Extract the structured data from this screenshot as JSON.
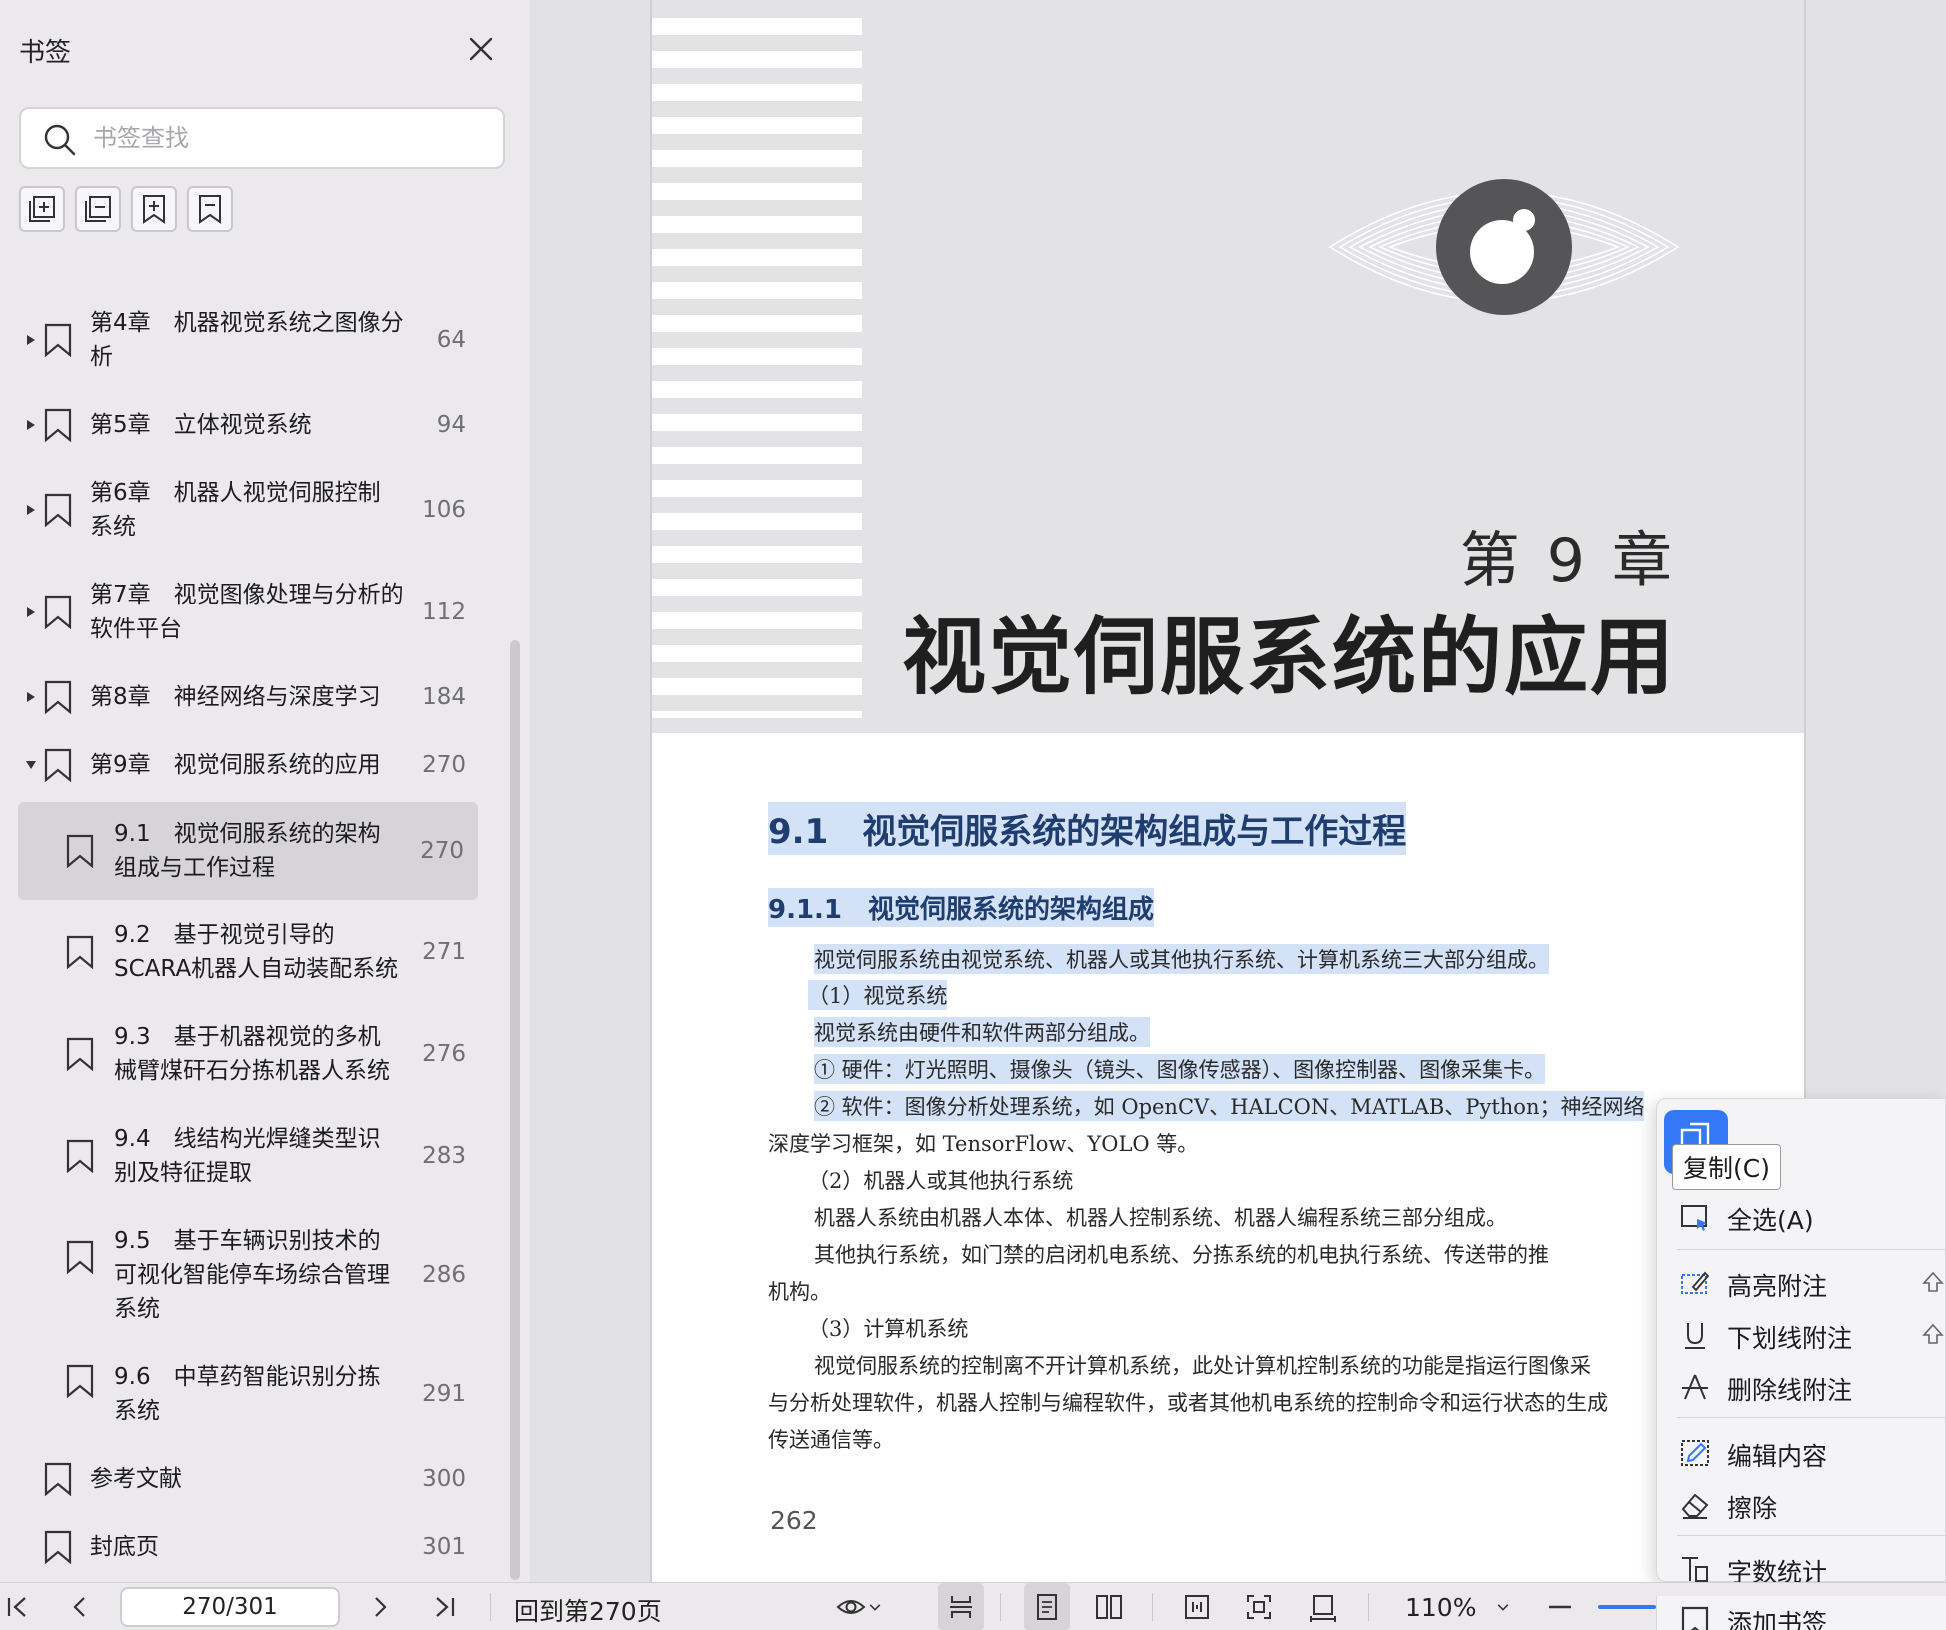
{
  "sidebar": {
    "title": "书签",
    "search_placeholder": "书签查找",
    "bookmarks": [
      {
        "label": "第4章　机器视觉系统之图像分\n析",
        "page": "64"
      },
      {
        "label": "第5章　立体视觉系统",
        "page": "94"
      },
      {
        "label": "第6章　机器人视觉伺服控制\n系统",
        "page": "106"
      },
      {
        "label": "第7章　视觉图像处理与分析的\n软件平台",
        "page": "112"
      },
      {
        "label": "第8章　神经网络与深度学习",
        "page": "184"
      },
      {
        "label": "第9章　视觉伺服系统的应用",
        "page": "270"
      },
      {
        "label": "9.1　视觉伺服系统的架构\n组成与工作过程",
        "page": "270"
      },
      {
        "label": "9.2　基于视觉引导的\nSCARA机器人自动装配系统",
        "page": "271"
      },
      {
        "label": "9.3　基于机器视觉的多机\n械臂煤矸石分拣机器人系统",
        "page": "276"
      },
      {
        "label": "9.4　线结构光焊缝类型识\n别及特征提取",
        "page": "283"
      },
      {
        "label": "9.5　基于车辆识别技术的\n可视化智能停车场综合管理\n系统",
        "page": "286"
      },
      {
        "label": "9.6　中草药智能识别分拣\n系统",
        "page": "291"
      },
      {
        "label": "参考文献",
        "page": "300"
      },
      {
        "label": "封底页",
        "page": "301"
      }
    ]
  },
  "document": {
    "chapter_num": "第 9 章",
    "chapter_title": "视觉伺服系统的应用",
    "section_1": "9.1　视觉伺服系统的架构组成与工作过程",
    "section_1_1": "9.1.1　视觉伺服系统的架构组成",
    "paragraphs": [
      "视觉伺服系统由视觉系统、机器人或其他执行系统、计算机系统三大部分组成。",
      "（1）视觉系统",
      "视觉系统由硬件和软件两部分组成。",
      "① 硬件：灯光照明、摄像头（镜头、图像传感器）、图像控制器、图像采集卡。",
      "② 软件：图像分析处理系统，如 OpenCV、HALCON、MATLAB、Python；神经网络",
      "深度学习框架，如 TensorFlow、YOLO 等。",
      "（2）机器人或其他执行系统",
      "机器人系统由机器人本体、机器人控制系统、机器人编程系统三部分组成。",
      "其他执行系统，如门禁的启闭机电系统、分拣系统的机电执行系统、传送带的推",
      "机构。",
      "（3）计算机系统",
      "视觉伺服系统的控制离不开计算机系统，此处计算机控制系统的功能是指运行图像采",
      "与分析处理软件，机器人控制与编程软件，或者其他机电系统的控制命令和运行状态的生成",
      "传送通信等。"
    ],
    "page_number": "262"
  },
  "context_menu": {
    "tooltip": "复制(C)",
    "items": [
      "全选(A)",
      "高亮附注",
      "下划线附注",
      "删除线附注",
      "编辑内容",
      "擦除",
      "字数统计",
      "添加书签"
    ]
  },
  "bottombar": {
    "page_indicator": "270/301",
    "back_to": "回到第270页",
    "zoom": "110%"
  },
  "colors": {
    "accent": "#3478f6",
    "selection_highlight": "#d4e2f7",
    "heading_blue": "#1f3d6e"
  }
}
